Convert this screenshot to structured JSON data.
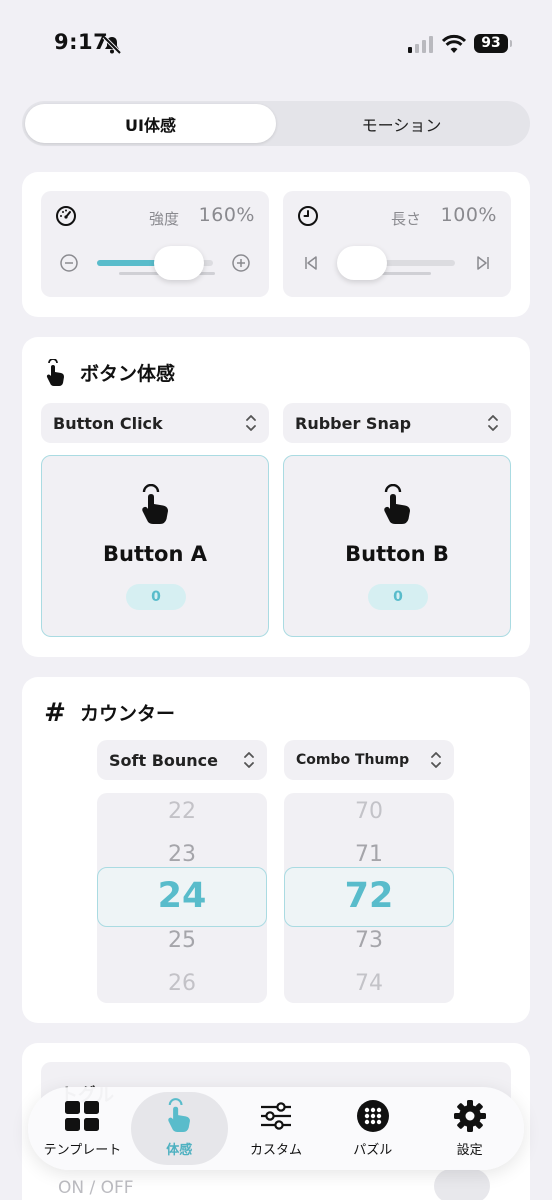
{
  "status_bar": {
    "time": "9:17",
    "battery": "93"
  },
  "segment": {
    "tabs": [
      "UI体感",
      "モーション"
    ],
    "active": 0
  },
  "sliders": {
    "strength": {
      "label": "強度",
      "value": "160%",
      "level": 0.71
    },
    "length": {
      "label": "長さ",
      "value": "100%",
      "level": 0.2
    }
  },
  "button_section": {
    "title": "ボタン体感",
    "select_a": "Button Click",
    "select_b": "Rubber Snap",
    "button_a": {
      "name": "Button A",
      "count": "0"
    },
    "button_b": {
      "name": "Button B",
      "count": "0"
    }
  },
  "counter_section": {
    "title": "カウンター",
    "icon": "#",
    "select_a": "Soft Bounce",
    "select_b": "Combo Thump",
    "picker_a": [
      "22",
      "23",
      "24",
      "25",
      "26"
    ],
    "picker_b": [
      "70",
      "71",
      "72",
      "73",
      "74"
    ]
  },
  "partial_section": {
    "title": "トグル",
    "toggle_label": "ON / OFF"
  },
  "tabbar": {
    "tabs": [
      "テンプレート",
      "体感",
      "カスタム",
      "パズル",
      "設定"
    ],
    "active": 1
  },
  "colors": {
    "accent": "#59bccb",
    "background": "#f1f0f5"
  }
}
